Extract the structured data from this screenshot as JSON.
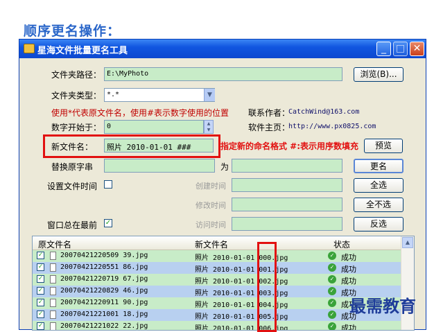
{
  "heading": "顺序更名操作：",
  "window": {
    "title": "星海文件批量更名工具",
    "minimize_glyph": "_",
    "maximize_glyph": "□",
    "close_glyph": "✕"
  },
  "form": {
    "folder_path_label": "文件夹路径：",
    "folder_path_value": "E:\\MyPhoto",
    "browse_label": "浏览(B)...",
    "folder_type_label": "文件夹类型：",
    "folder_type_value": "*.*",
    "hint": "使用*代表原文件名，使用#表示数字使用的位置",
    "contact_label": "联系作者：",
    "contact_value": "CatchWind@163.com",
    "homepage_label": "软件主页：",
    "homepage_value": "http://www.px0825.com",
    "num_start_label": "数字开始于：",
    "num_start_value": "0",
    "new_name_label": "新文件名：",
    "new_name_value": "照片 2010-01-01 ###",
    "annotation": "指定新的命名格式 #:表示用序数填充",
    "preview_label": "预览",
    "replace_label": "替换原字串",
    "replace_for": "为",
    "rename_label": "更名",
    "set_time_label": "设置文件时间",
    "select_all_label": "全选",
    "created_label": "创建时间",
    "deselect_all_label": "全不选",
    "modified_label": "修改时间",
    "always_top_label": "窗口总在最前",
    "always_top_checked": true,
    "invert_label": "反选",
    "accessed_label": "访问时间"
  },
  "list": {
    "columns": [
      "原文件名",
      "新文件名",
      "状态"
    ],
    "rows": [
      {
        "orig": "20070421220509 39.jpg",
        "new": "照片 2010-01-01 000.jpg",
        "status": "成功"
      },
      {
        "orig": "20070421220551 86.jpg",
        "new": "照片 2010-01-01 001.jpg",
        "status": "成功"
      },
      {
        "orig": "20070421220719 67.jpg",
        "new": "照片 2010-01-01 002.jpg",
        "status": "成功"
      },
      {
        "orig": "20070421220829 46.jpg",
        "new": "照片 2010-01-01 003.jpg",
        "status": "成功"
      },
      {
        "orig": "20070421220911 90.jpg",
        "new": "照片 2010-01-01 004.jpg",
        "status": "成功"
      },
      {
        "orig": "20070421221001 18.jpg",
        "new": "照片 2010-01-01 005.jpg",
        "status": "成功"
      },
      {
        "orig": "20070421221022 22.jpg",
        "new": "照片 2010-01-01 006.jpg",
        "status": "成功"
      }
    ]
  },
  "watermark": "最需教育",
  "colors": {
    "accent": "#2a66c9",
    "annotation_red": "#e21010",
    "field_green": "#c8ecc8",
    "row_highlight": "#b8d0f0"
  }
}
